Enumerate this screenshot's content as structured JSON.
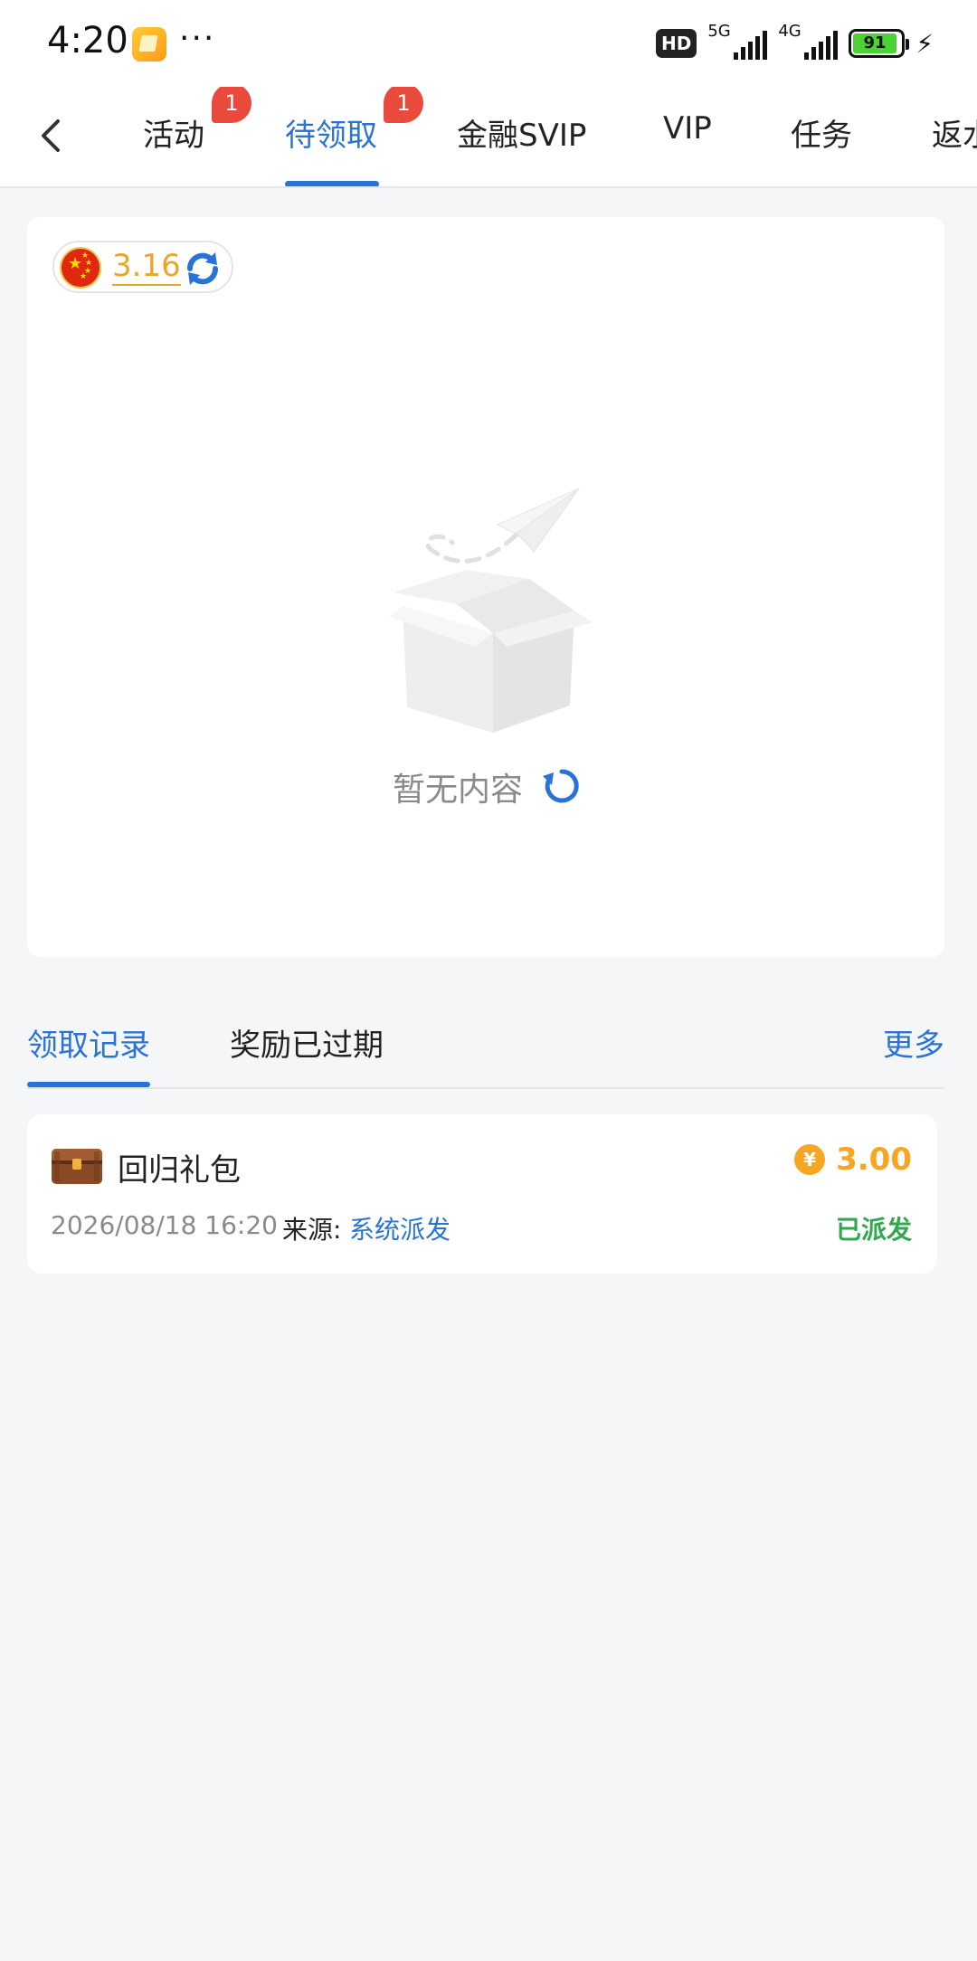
{
  "status_bar": {
    "time": "4:20",
    "more": "···",
    "hd_badge": "HD",
    "network_1": "5G",
    "network_2": "4G",
    "battery": "91",
    "app_icon": "notes-app-icon",
    "charging_icon": "lightning-icon"
  },
  "tabs": [
    {
      "label": "活动",
      "badge": "1"
    },
    {
      "label": "待领取",
      "badge": "1"
    },
    {
      "label": "金融SVIP"
    },
    {
      "label": "VIP"
    },
    {
      "label": "任务"
    },
    {
      "label": "返水"
    }
  ],
  "active_tab": "待领取",
  "currency": {
    "flag": "china-flag-icon",
    "rate": "3.16"
  },
  "empty_state": {
    "text": "暂无内容"
  },
  "record_tabs": {
    "records": "领取记录",
    "expired": "奖励已过期",
    "more": "更多"
  },
  "records": [
    {
      "title": "回归礼包",
      "amount": "3.00",
      "currency_symbol": "¥",
      "time": "2026/08/18 16:20",
      "source_label": "来源:",
      "source": "系统派发",
      "status": "已派发"
    }
  ],
  "colors": {
    "accent": "#2a73d6",
    "badge": "#ea4a3b",
    "gold": "#f5a623",
    "success": "#2fa84f"
  }
}
